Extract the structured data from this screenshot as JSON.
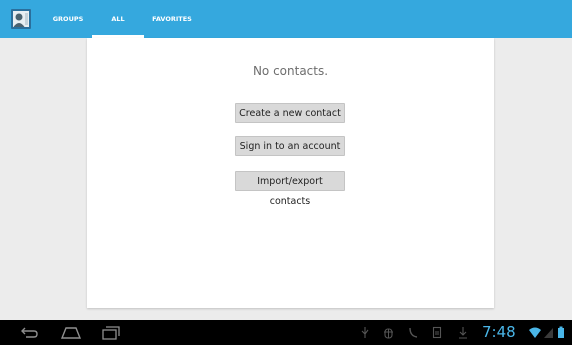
{
  "actionbar": {
    "app_icon": "contacts-app-icon",
    "tabs": [
      {
        "label": "GROUPS",
        "selected": false
      },
      {
        "label": "ALL",
        "selected": true
      },
      {
        "label": "FAVORITES",
        "selected": false
      }
    ],
    "background_color": "#35a8de"
  },
  "main": {
    "empty_message": "No contacts.",
    "buttons": {
      "create_label": "Create a new contact",
      "signin_label": "Sign in to an account",
      "import_label": "Import/export contacts"
    }
  },
  "navbar": {
    "buttons": [
      "back-icon",
      "home-icon",
      "recent-apps-icon"
    ],
    "status_icons": [
      "usb-icon",
      "debug-icon",
      "phone-icon",
      "sd-card-icon",
      "download-icon",
      "wifi-icon",
      "signal-icon",
      "battery-icon"
    ],
    "clock": "7:48",
    "accent_color": "#4ab6e8"
  }
}
